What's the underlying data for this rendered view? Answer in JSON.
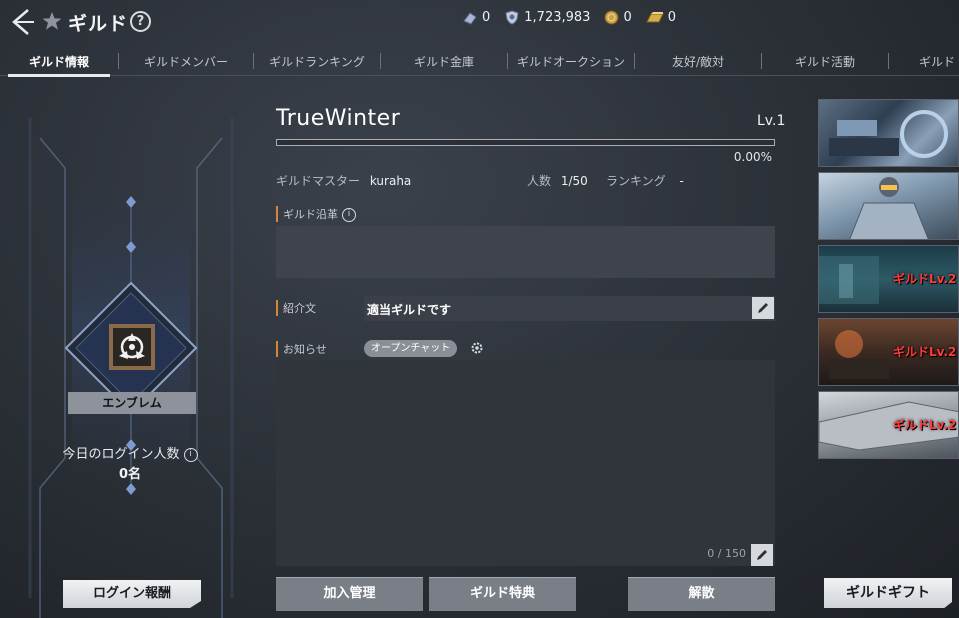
{
  "header": {
    "title": "ギルド",
    "help": "?",
    "currencies": [
      {
        "icon": "crystal-icon",
        "value": "0"
      },
      {
        "icon": "shield-coin-icon",
        "value": "1,723,983"
      },
      {
        "icon": "gold-coin-icon",
        "value": "0"
      },
      {
        "icon": "gold-bar-icon",
        "value": "0"
      }
    ]
  },
  "tabs": [
    "ギルド情報",
    "ギルドメンバー",
    "ギルドランキング",
    "ギルド金庫",
    "ギルドオークション",
    "友好/敵対",
    "ギルド活動",
    "ギルド"
  ],
  "active_tab": 0,
  "left": {
    "emblem_label": "エンブレム",
    "login_title": "今日のログイン人数",
    "login_count": "0名",
    "login_reward_button": "ログイン報酬"
  },
  "guild": {
    "name": "TrueWinter",
    "level": "Lv.1",
    "xp_percent_text": "0.00%",
    "xp_fraction": 0.0,
    "master_label": "ギルドマスター",
    "master_value": "kuraha",
    "members_label": "人数",
    "members_value": "1/50",
    "ranking_label": "ランキング",
    "ranking_value": "-",
    "history_label": "ギルド沿革",
    "intro_label": "紹介文",
    "intro_text": "適当ギルドです",
    "notice_label": "お知らせ",
    "open_chat": "オープンチャット",
    "notice_count": "0 / 150"
  },
  "buttons": {
    "join_manage": "加入管理",
    "guild_perks": "ギルド特典",
    "disband": "解散",
    "guild_gift": "ギルドギフト"
  },
  "banners": [
    {
      "tag": ""
    },
    {
      "tag": ""
    },
    {
      "tag": "ギルドLv.2"
    },
    {
      "tag": "ギルドLv.2"
    },
    {
      "tag": "ギルドLv.2"
    }
  ]
}
